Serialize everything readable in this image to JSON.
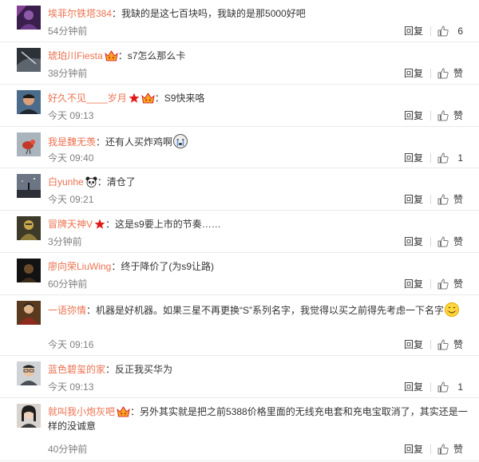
{
  "comments": [
    {
      "user": "埃菲尔铁塔384",
      "text": "：我缺的是这七百块吗，我缺的是那5000好吧",
      "time": "54分钟前",
      "reply": "回复",
      "like": "6",
      "avatar": "purple-portrait"
    },
    {
      "user": "琥珀川Fiesta",
      "text": "：s7怎么那么卡",
      "time": "38分钟前",
      "reply": "回复",
      "like": "赞",
      "badges": [
        "vip-crown-icon"
      ],
      "avatar": "dark-landscape"
    },
    {
      "user": "好久不见____岁月",
      "text": "：S9快来咯",
      "time": "今天 09:13",
      "reply": "回复",
      "like": "赞",
      "badges": [
        "red-star-icon",
        "vip-crown-icon"
      ],
      "avatar": "man-portrait"
    },
    {
      "user": "我是魏无羡",
      "text": "：还有人买炸鸡啊",
      "time": "今天 09:40",
      "reply": "回复",
      "like": "1",
      "emoji": "crying-face-icon",
      "avatar": "bird"
    },
    {
      "user": "白yunhe",
      "text": "：清仓了",
      "time": "今天 09:21",
      "reply": "回复",
      "like": "赞",
      "badges": [
        "panda-icon"
      ],
      "avatar": "night-sky"
    },
    {
      "user": "冒牌天神V",
      "text": "：这是s9要上市的节奏……",
      "time": "3分钟前",
      "reply": "回复",
      "like": "赞",
      "badges": [
        "red-star-icon"
      ],
      "avatar": "character"
    },
    {
      "user": "廖向荣LiuWing",
      "text": "：终于降价了(为s9让路)",
      "time": "60分钟前",
      "reply": "回复",
      "like": "赞",
      "avatar": "dark-figure"
    },
    {
      "user": "一语弥情",
      "text": "：机器是好机器。如果三星不再更换“S”系列名字，我觉得以买之前得先考虑一下名字",
      "time": "今天 09:16",
      "reply": "回复",
      "like": "赞",
      "emoji": "smile-emoji-icon",
      "avatar": "warrior"
    },
    {
      "user": "蓝色碧玺的家",
      "text": "：反正我买华为",
      "time": "今天 09:13",
      "reply": "回复",
      "like": "1",
      "avatar": "man-glasses"
    },
    {
      "user": "就叫我小炮灰吧",
      "text": "：另外其实就是把之前5388价格里面的无线充电套和充电宝取消了，其实还是一样的没诚意",
      "time": "40分钟前",
      "reply": "回复",
      "like": "赞",
      "badges": [
        "vip-crown-icon"
      ],
      "avatar": "woman-portrait"
    }
  ],
  "colors": {
    "username": "#eb7350",
    "text": "#333333",
    "time": "#808080",
    "divider": "#e9e9e9"
  }
}
